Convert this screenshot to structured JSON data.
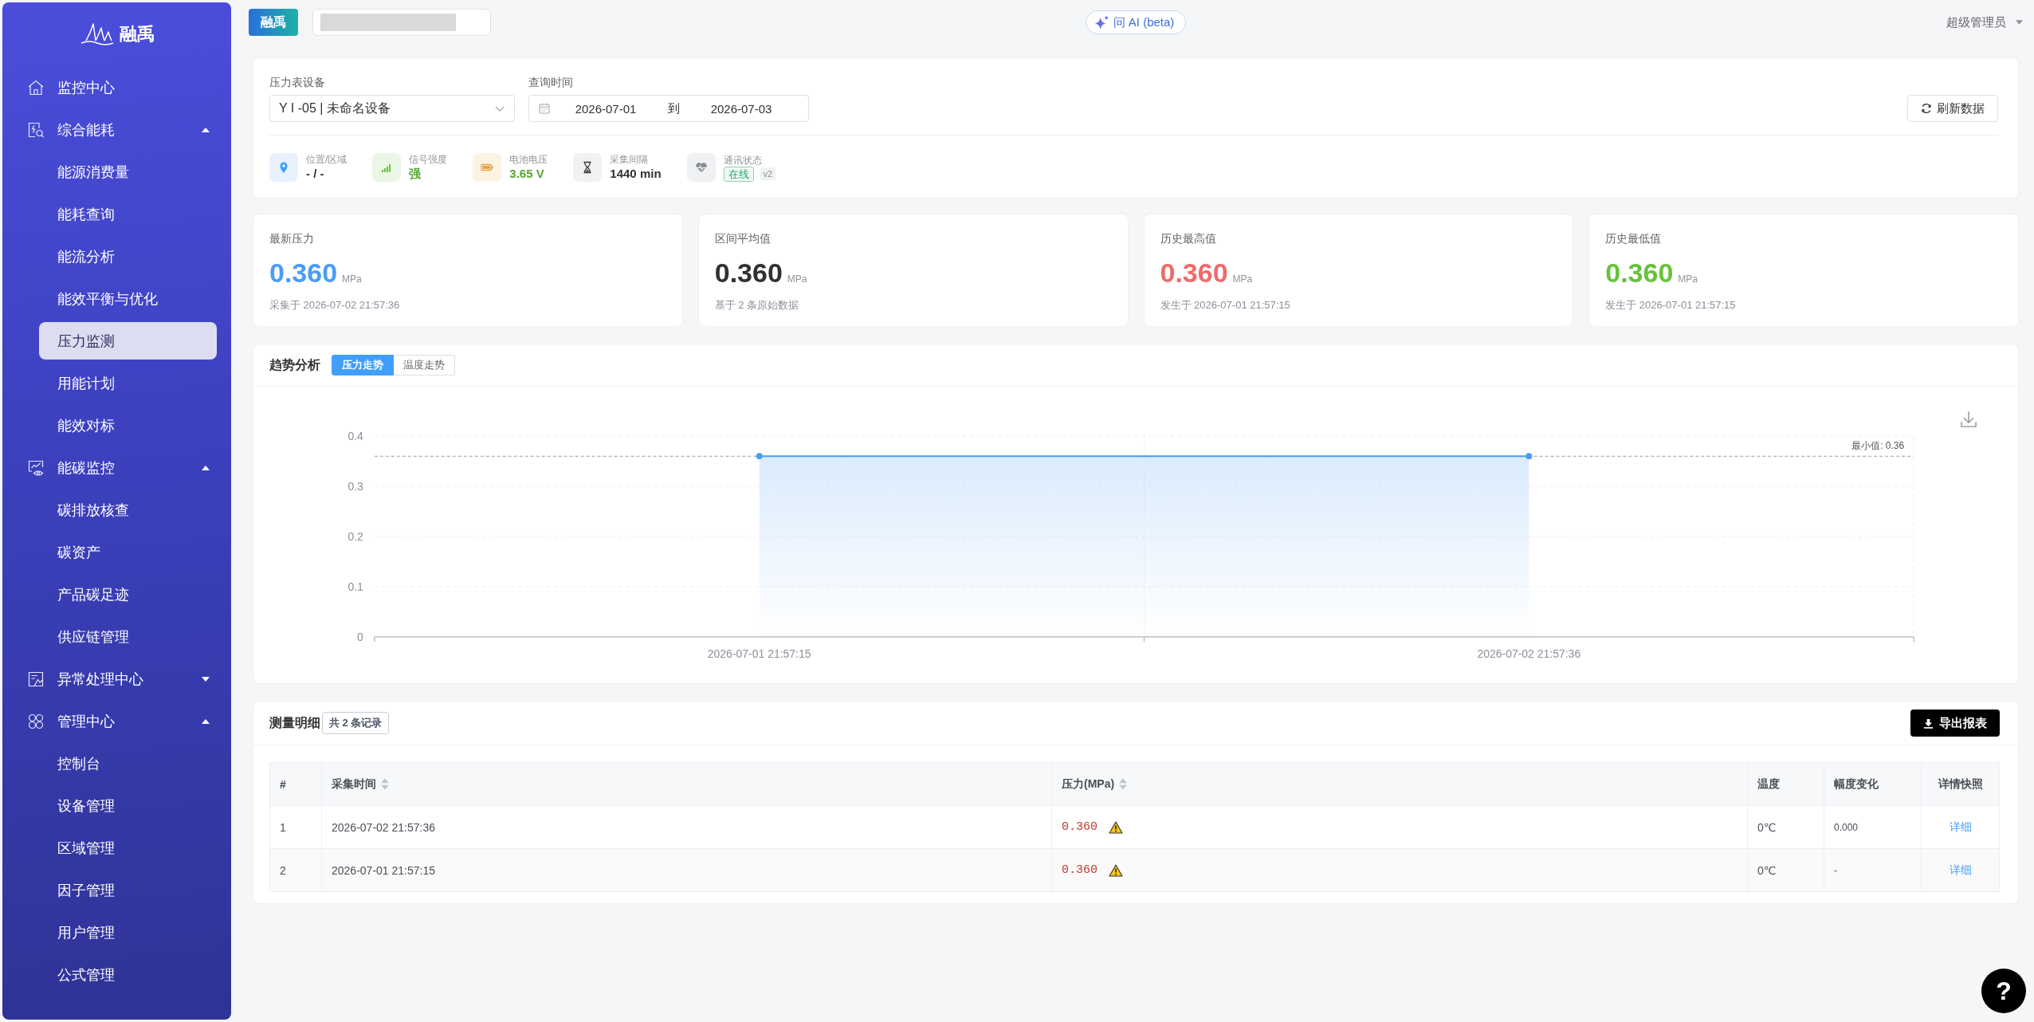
{
  "sidebar": {
    "logo": "融禹",
    "items": [
      {
        "kind": "link",
        "label": "监控中心",
        "selected": false
      },
      {
        "kind": "group",
        "label": "综合能耗",
        "selected": false,
        "expanded": true,
        "children": [
          {
            "label": "能源消费量",
            "selected": false
          },
          {
            "label": "能耗查询",
            "selected": false
          },
          {
            "label": "能流分析",
            "selected": false
          },
          {
            "label": "能效平衡与优化",
            "selected": false
          },
          {
            "label": "压力监测",
            "selected": true
          },
          {
            "label": "用能计划",
            "selected": false
          },
          {
            "label": "能效对标",
            "selected": false
          }
        ]
      },
      {
        "kind": "group",
        "label": "能碳监控",
        "selected": false,
        "expanded": true,
        "children": [
          {
            "label": "碳排放核查",
            "selected": false
          },
          {
            "label": "碳资产",
            "selected": false
          },
          {
            "label": "产品碳足迹",
            "selected": false
          },
          {
            "label": "供应链管理",
            "selected": false
          }
        ]
      },
      {
        "kind": "group",
        "label": "异常处理中心",
        "selected": false,
        "expanded": false
      },
      {
        "kind": "group",
        "label": "管理中心",
        "selected": false,
        "expanded": true,
        "children": [
          {
            "label": "控制台",
            "selected": false
          },
          {
            "label": "设备管理",
            "selected": false
          },
          {
            "label": "区域管理",
            "selected": false
          },
          {
            "label": "因子管理",
            "selected": false
          },
          {
            "label": "用户管理",
            "selected": false
          },
          {
            "label": "公式管理",
            "selected": false
          }
        ]
      }
    ]
  },
  "topbar": {
    "brand_button": "融禹",
    "ai_button": "问 AI (beta)",
    "user_menu": "超级管理员"
  },
  "filters": {
    "device": {
      "label": "压力表设备",
      "value": "Y I -05 | 未命名设备"
    },
    "date_range": {
      "label": "查询时间",
      "start": "2026-07-01",
      "separator": "到",
      "end": "2026-07-03"
    },
    "refresh_button": "刷新数据",
    "info": [
      {
        "kind": "location",
        "label": "位置/区域",
        "value": "- / -"
      },
      {
        "kind": "signal",
        "label": "信号强度",
        "value": "强"
      },
      {
        "kind": "battery",
        "label": "电池电压",
        "value": "3.65 V"
      },
      {
        "kind": "interval",
        "label": "采集间隔",
        "value": "1440 min"
      },
      {
        "kind": "status",
        "label": "通讯状态",
        "value": "在线",
        "version": "v2"
      }
    ]
  },
  "stats": [
    {
      "label": "最新压力",
      "value": "0.360",
      "unit": "MPa",
      "note": "采集于 2026-07-02 21:57:36",
      "color": "#4a9cf6"
    },
    {
      "label": "区间平均值",
      "value": "0.360",
      "unit": "MPa",
      "note": "基于 2 条原始数据",
      "color": "#303133"
    },
    {
      "label": "历史最高值",
      "value": "0.360",
      "unit": "MPa",
      "note": "发生于 2026-07-01 21:57:15",
      "color": "#ee6b6b"
    },
    {
      "label": "历史最低值",
      "value": "0.360",
      "unit": "MPa",
      "note": "发生于 2026-07-01 21:57:15",
      "color": "#67c23a"
    }
  ],
  "trend": {
    "title": "趋势分析",
    "tabs": [
      {
        "label": "压力走势",
        "selected": true
      },
      {
        "label": "温度走势",
        "selected": false
      }
    ],
    "chart_data": {
      "type": "area",
      "categories": [
        "2026-07-01 21:57:15",
        "2026-07-02 21:57:36"
      ],
      "series": [
        {
          "color": "#4a9cf6",
          "values": [
            0.36,
            0.36
          ]
        }
      ],
      "ylim": [
        0,
        0.4
      ],
      "yticks": [
        0,
        0.1,
        0.2,
        0.3,
        0.4
      ],
      "grid": true,
      "ref_lines": [
        {
          "axis": "y",
          "value": 0.36,
          "label": "最小值: 0.36"
        }
      ]
    }
  },
  "table": {
    "title": "测量明细",
    "count": "共 2 条记录",
    "export_button": "导出报表",
    "columns": [
      {
        "label": "#",
        "sortable": false
      },
      {
        "label": "采集时间",
        "sortable": true
      },
      {
        "label": "压力(MPa)",
        "sortable": true
      },
      {
        "label": "温度",
        "sortable": false
      },
      {
        "label": "幅度变化",
        "sortable": false
      },
      {
        "label": "详情快照",
        "sortable": false
      }
    ],
    "rows": [
      {
        "index": "1",
        "time": "2026-07-02 21:57:36",
        "pressure": "0.360",
        "warning": true,
        "temperature": "0℃",
        "change": "0.000",
        "action": "详细"
      },
      {
        "index": "2",
        "time": "2026-07-01 21:57:15",
        "pressure": "0.360",
        "warning": true,
        "temperature": "0℃",
        "change": "-",
        "action": "详细"
      }
    ]
  },
  "help_button": "?"
}
